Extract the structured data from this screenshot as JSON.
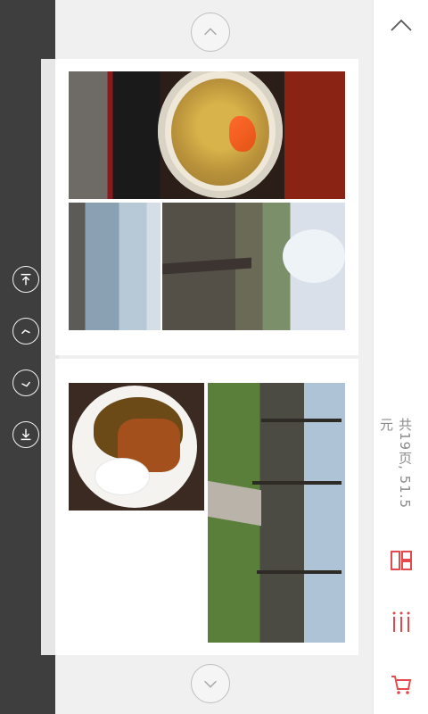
{
  "viewer": {
    "summary": "共19页, 51.5元"
  },
  "colors": {
    "accent": "#e5484d",
    "rail_bg": "#3e3e3e",
    "text_muted": "#8c8c8c"
  },
  "icons": {
    "top_nav": "chevron-up-circle-icon",
    "bottom_nav": "chevron-down-circle-icon",
    "right_collapse": "chevron-up-icon",
    "side_first": "jump-first-icon",
    "side_prev": "prev-page-icon",
    "side_next": "next-page-icon",
    "side_last": "jump-last-icon",
    "layout": "layout-icon",
    "list": "list-icon",
    "cart": "cart-icon"
  }
}
